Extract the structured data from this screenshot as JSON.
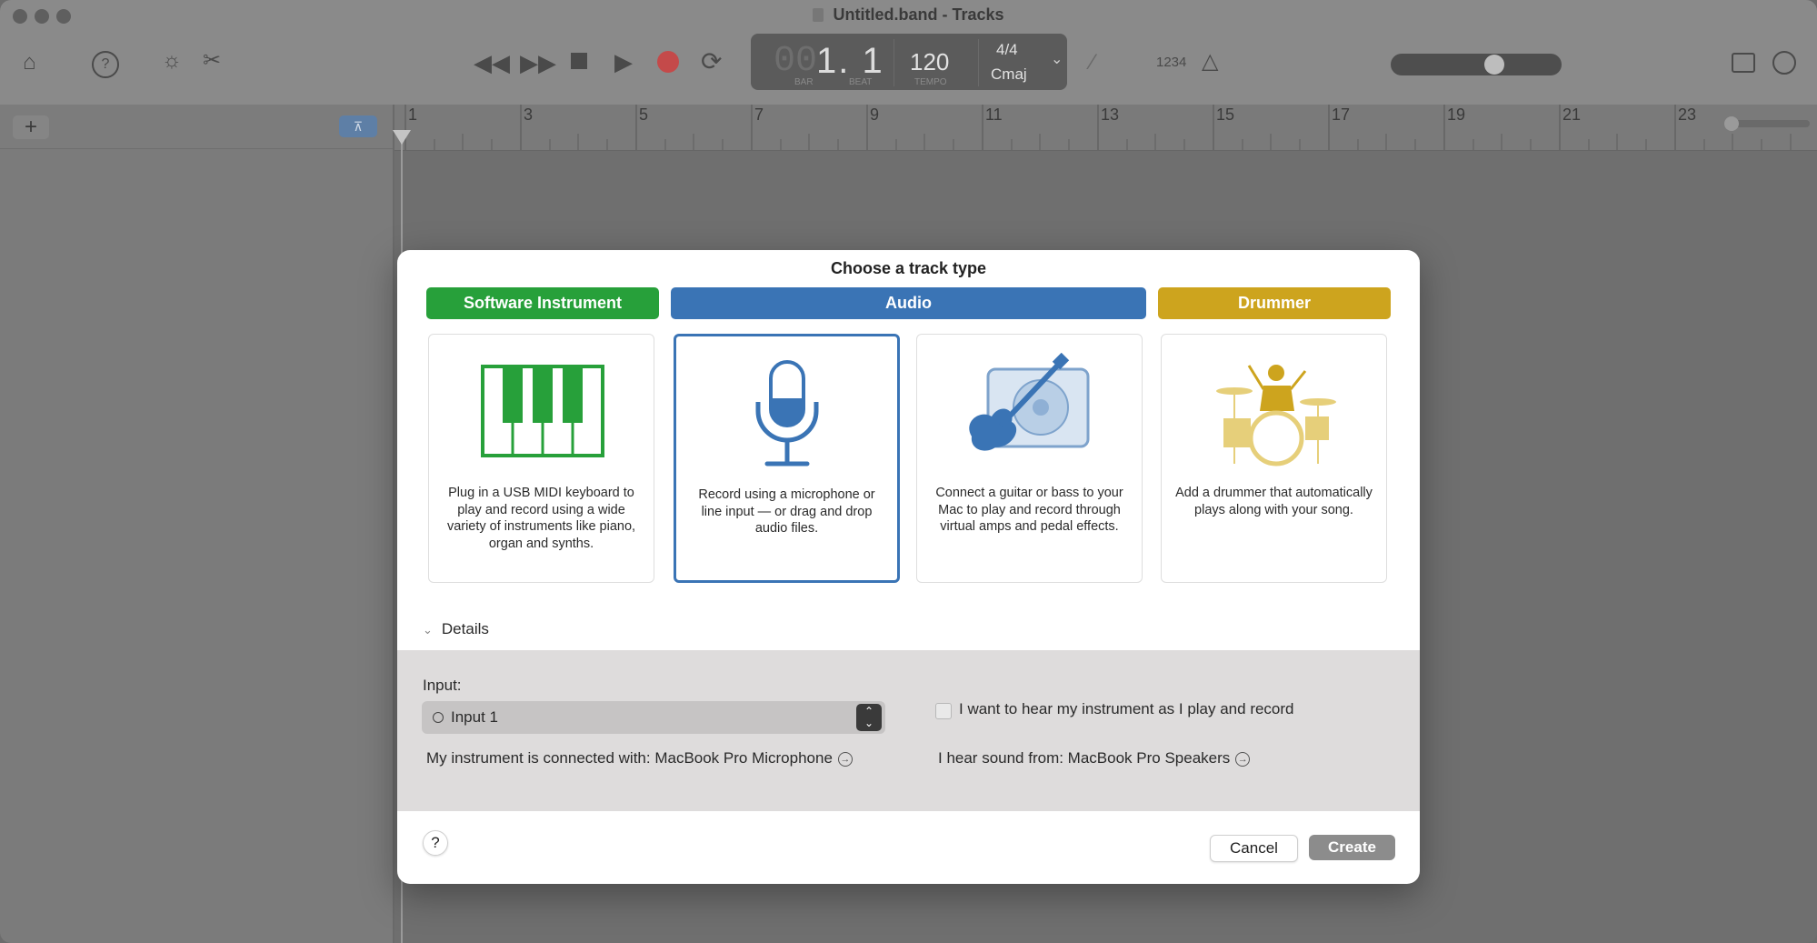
{
  "window": {
    "title": "Untitled.band - Tracks"
  },
  "toolbar": {
    "icons": [
      "library-icon",
      "help-icon",
      "smart-controls-icon",
      "editors-icon",
      "rewind-icon",
      "fast-forward-icon",
      "stop-icon",
      "play-icon",
      "record-icon",
      "cycle-icon",
      "tuner-icon",
      "count-in-icon",
      "metronome-icon",
      "notepad-icon",
      "loop-browser-icon"
    ],
    "lcd": {
      "position_faint": "00",
      "position": "1. 1",
      "bar_label": "BAR",
      "beat_label": "BEAT",
      "tempo": "120",
      "tempo_label": "TEMPO",
      "time_signature": "4/4",
      "key": "Cmaj"
    },
    "count_in_label": "1234",
    "master_volume": 0.62
  },
  "tracks": {
    "add_label": "+",
    "ruler_bars": [
      "1",
      "3",
      "5",
      "7",
      "9",
      "11",
      "13",
      "15",
      "17",
      "19",
      "21",
      "23"
    ]
  },
  "dialog": {
    "title": "Choose a track type",
    "track_types": [
      {
        "label": "Software Instrument",
        "color": "#27a03a"
      },
      {
        "label": "Audio",
        "color": "#3a74b5"
      },
      {
        "label": "Drummer",
        "color": "#cda41e"
      }
    ],
    "cards": [
      {
        "desc": "Plug in a USB MIDI keyboard to play and record using a wide variety of instruments like piano, organ and synths."
      },
      {
        "desc": "Record using a microphone or line input — or drag and drop audio files."
      },
      {
        "desc": "Connect a guitar or bass to your Mac to play and record through virtual amps and pedal effects."
      },
      {
        "desc": "Add a drummer that automatically plays along with your song."
      }
    ],
    "details_label": "Details",
    "input_label": "Input:",
    "input_value": "Input 1",
    "monitor_label": "I want to hear my instrument as I play and record",
    "connected_with": "My instrument is connected with: MacBook Pro Microphone",
    "hear_from": "I hear sound from: MacBook Pro Speakers",
    "help_label": "?",
    "cancel_label": "Cancel",
    "create_label": "Create"
  }
}
